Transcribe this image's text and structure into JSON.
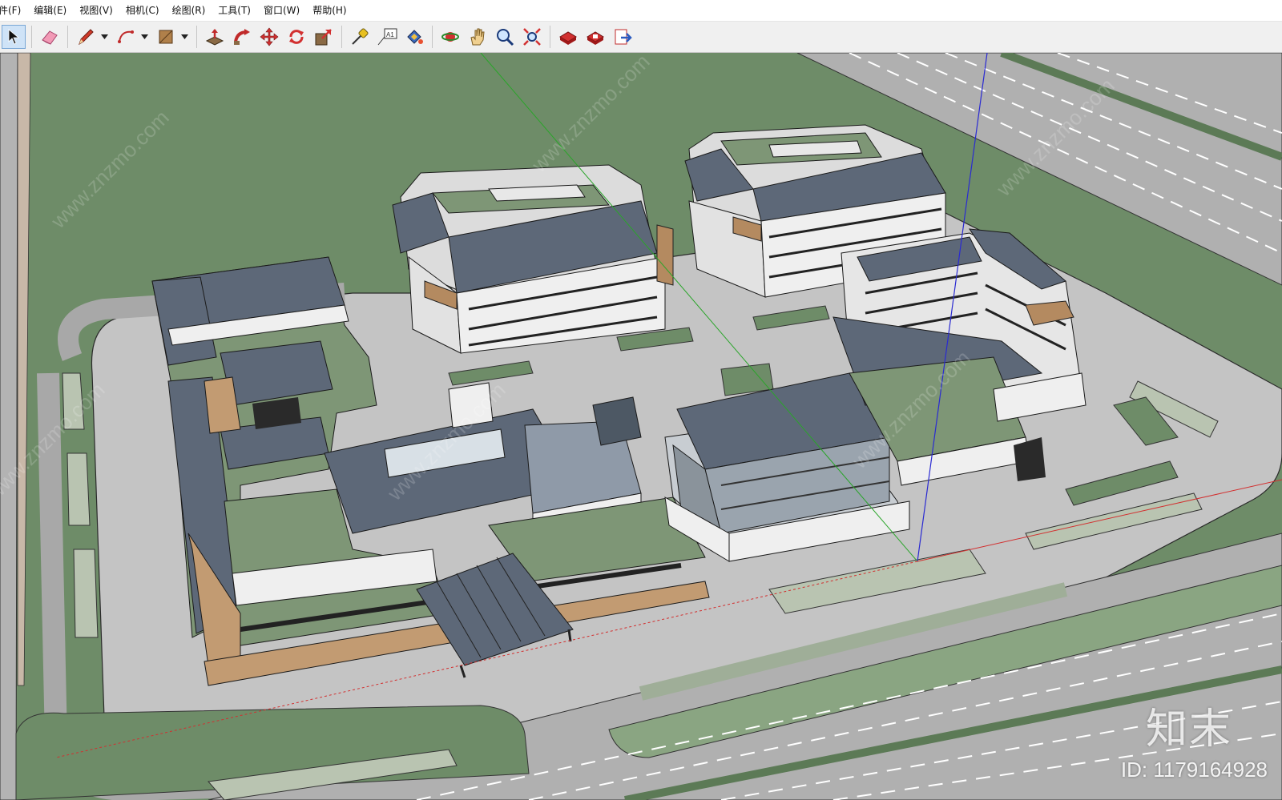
{
  "menu": {
    "items": [
      {
        "label": "件(F)"
      },
      {
        "label": "编辑(E)"
      },
      {
        "label": "视图(V)"
      },
      {
        "label": "相机(C)"
      },
      {
        "label": "绘图(R)"
      },
      {
        "label": "工具(T)"
      },
      {
        "label": "窗口(W)"
      },
      {
        "label": "帮助(H)"
      }
    ]
  },
  "toolbar": {
    "tools": [
      {
        "icon": "select-arrow-icon"
      },
      {
        "icon": "eraser-icon"
      },
      {
        "icon": "pencil-line-icon"
      },
      {
        "icon": "arc-icon"
      },
      {
        "icon": "rectangle-icon"
      },
      {
        "icon": "push-pull-icon"
      },
      {
        "icon": "follow-me-icon"
      },
      {
        "icon": "move-icon"
      },
      {
        "icon": "rotate-icon"
      },
      {
        "icon": "scale-icon"
      },
      {
        "icon": "tape-measure-icon"
      },
      {
        "icon": "text-label-icon"
      },
      {
        "icon": "paint-bucket-icon"
      },
      {
        "icon": "orbit-icon"
      },
      {
        "icon": "pan-hand-icon"
      },
      {
        "icon": "zoom-icon"
      },
      {
        "icon": "zoom-extents-icon"
      },
      {
        "icon": "3d-warehouse-icon"
      },
      {
        "icon": "extension-warehouse-icon"
      },
      {
        "icon": "share-model-icon"
      }
    ],
    "text_tool_glyph": "A1"
  },
  "colors": {
    "grass": "#6e8c68",
    "paving": "#c4c4c4",
    "road": "#b0b0b0",
    "roof": "#5d6878",
    "facade": "#efefef",
    "axis_red": "#d23030",
    "axis_green": "#2aa52a",
    "axis_blue": "#2a2ad2"
  },
  "watermark": {
    "brand": "知末",
    "id": "ID: 1179164928",
    "diagonal": "www.znzmo.com"
  }
}
